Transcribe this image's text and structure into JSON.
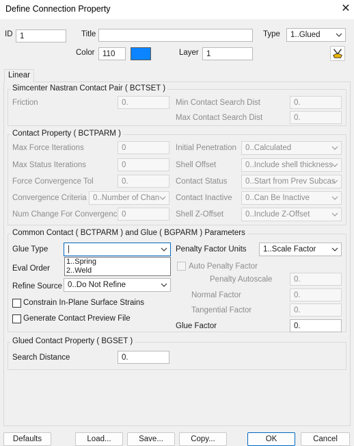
{
  "window": {
    "title": "Define Connection Property",
    "close_icon": "close-icon"
  },
  "header": {
    "id_label": "ID",
    "id_value": "1",
    "title_label": "Title",
    "title_value": "",
    "type_label": "Type",
    "type_value": "1..Glued",
    "color_label": "Color",
    "color_value": "110",
    "color_swatch": "#0b84ff",
    "layer_label": "Layer",
    "layer_value": "1"
  },
  "tabs": [
    {
      "label": "Linear"
    }
  ],
  "bctset": {
    "title": "Simcenter Nastran Contact Pair ( BCTSET )",
    "friction_label": "Friction",
    "friction_value": "0.",
    "min_dist_label": "Min Contact Search Dist",
    "min_dist_value": "0.",
    "max_dist_label": "Max Contact Search Dist",
    "max_dist_value": "0."
  },
  "bctparm": {
    "title": "Contact Property ( BCTPARM )",
    "max_force_iter_label": "Max Force Iterations",
    "max_force_iter_value": "0",
    "max_status_iter_label": "Max Status Iterations",
    "max_status_iter_value": "0",
    "force_tol_label": "Force Convergence Tol",
    "force_tol_value": "0.",
    "conv_criteria_label": "Convergence Criteria",
    "conv_criteria_value": "0..Number of Chan",
    "num_change_label": "Num Change For Convergence",
    "num_change_value": "0",
    "init_pen_label": "Initial Penetration",
    "init_pen_value": "0..Calculated",
    "shell_offset_label": "Shell Offset",
    "shell_offset_value": "0..Include shell thickness",
    "contact_status_label": "Contact Status",
    "contact_status_value": "0..Start from Prev Subcas",
    "contact_inactive_label": "Contact Inactive",
    "contact_inactive_value": "0..Can Be Inactive",
    "shell_zoffset_label": "Shell Z-Offset",
    "shell_zoffset_value": "0..Include Z-Offset"
  },
  "common": {
    "title": "Common Contact ( BCTPARM ) and Glue ( BGPARM ) Parameters",
    "glue_type_label": "Glue Type",
    "glue_type_value": "|",
    "glue_type_options": [
      "1..Spring",
      "2..Weld"
    ],
    "eval_order_label": "Eval Order",
    "refine_source_label": "Refine Source",
    "refine_source_value": "0..Do Not Refine",
    "constrain_label": "Constrain In-Plane Surface Strains",
    "preview_label": "Generate Contact Preview File",
    "penalty_units_label": "Penalty Factor Units",
    "penalty_units_value": "1..Scale Factor",
    "auto_penalty_label": "Auto Penalty Factor",
    "penalty_autoscale_label": "Penalty Autoscale",
    "penalty_autoscale_value": "0.",
    "normal_factor_label": "Normal Factor",
    "normal_factor_value": "0.",
    "tangential_factor_label": "Tangential Factor",
    "tangential_factor_value": "0.",
    "glue_factor_label": "Glue Factor",
    "glue_factor_value": "0."
  },
  "bgset": {
    "title": "Glued Contact Property ( BGSET )",
    "search_distance_label": "Search Distance",
    "search_distance_value": "0."
  },
  "buttons": {
    "defaults": "Defaults",
    "load": "Load...",
    "save": "Save...",
    "copy": "Copy...",
    "ok": "OK",
    "cancel": "Cancel"
  }
}
